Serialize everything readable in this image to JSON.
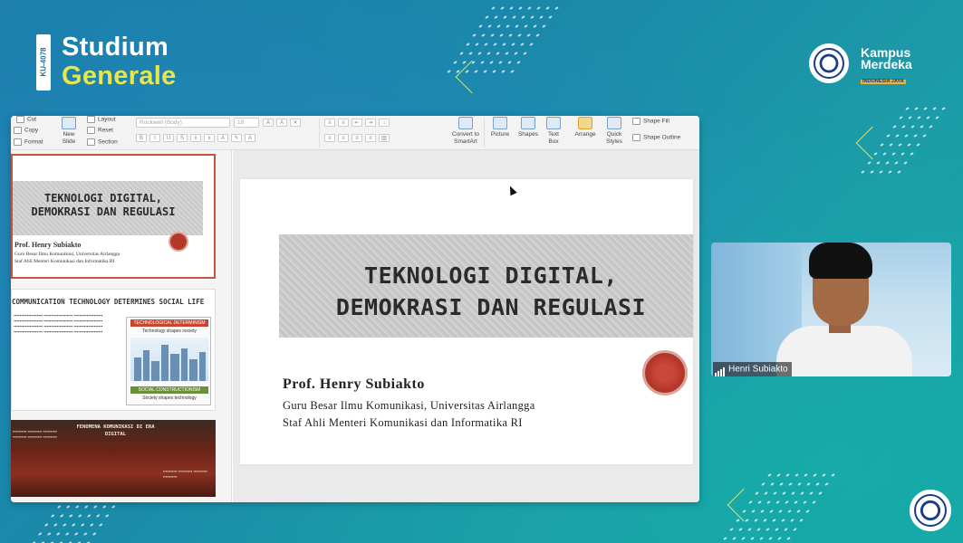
{
  "branding": {
    "course_code": "KU-4078",
    "title_line1": "Studium",
    "title_line2": "Generale",
    "partner_line1": "Kampus",
    "partner_line2": "Merdeka",
    "partner_tag": "INDONESIA JAYA"
  },
  "ribbon": {
    "cut": "Cut",
    "copy": "Copy",
    "format": "Format",
    "new_slide": "New Slide",
    "layout": "Layout",
    "reset": "Reset",
    "section": "Section",
    "font_name": "Rockwell (Body)",
    "font_size": "18",
    "convert": "Convert to SmartArt",
    "picture": "Picture",
    "shapes": "Shapes",
    "text_box": "Text Box",
    "arrange": "Arrange",
    "quick_styles": "Quick Styles",
    "shape_fill": "Shape Fill",
    "shape_outline": "Shape Outline"
  },
  "thumbnails": {
    "slide1": {
      "title": "TEKNOLOGI DIGITAL, DEMOKRASI DAN REGULASI",
      "name": "Prof. Henry Subiakto",
      "line1": "Guru Besar Ilmu Komunikasi, Universitas Airlangga",
      "line2": "Staf Ahli Menteri Komunikasi dan Informatika RI"
    },
    "slide2": {
      "heading": "COMMUNICATION TECHNOLOGY DETERMINES SOCIAL LIFE",
      "card_top": "TECHNOLOGICAL DETERMINISM",
      "card_sub": "Technology shapes society",
      "card_bottom": "SOCIAL CONSTRUCTIONISM",
      "card_sub2": "Society shapes technology"
    },
    "slide3": {
      "title": "FENOMENA KOMUNIKASI DI ERA DIGITAL"
    }
  },
  "slide": {
    "title_line1": "TEKNOLOGI DIGITAL,",
    "title_line2": "DEMOKRASI DAN REGULASI",
    "presenter": "Prof. Henry Subiakto",
    "line1": "Guru Besar Ilmu Komunikasi, Universitas  Airlangga",
    "line2": "Staf Ahli Menteri Komunikasi dan Informatika RI"
  },
  "webcam": {
    "participant_name": "Henri Subiakto"
  },
  "colors": {
    "accent_yellow": "#e8e64d",
    "seal_red": "#b5382a",
    "background": "#1a8aa9"
  }
}
